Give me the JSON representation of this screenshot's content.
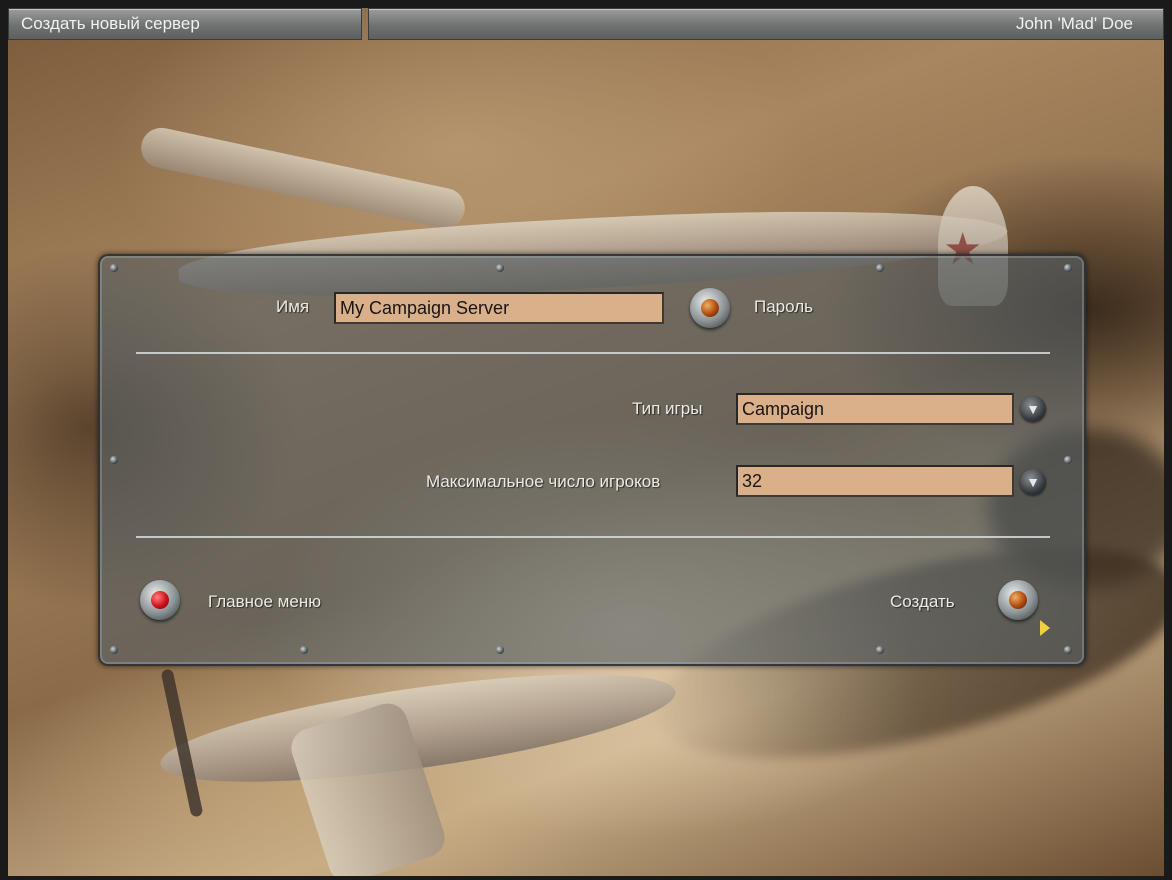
{
  "header": {
    "title": "Создать новый сервер",
    "user": "John 'Mad' Doe"
  },
  "form": {
    "name_label": "Имя",
    "name_value": "My Campaign Server",
    "password_label": "Пароль",
    "game_type_label": "Тип игры",
    "game_type_value": "Campaign",
    "max_players_label": "Максимальное число игроков",
    "max_players_value": "32"
  },
  "footer": {
    "main_menu_label": "Главное меню",
    "create_label": "Создать"
  },
  "icons": {
    "dropdown": "chevron-down-icon",
    "toggle": "lamp-button-icon"
  },
  "colors": {
    "field_bg": "#d9b08a",
    "panel_bg": "#566064",
    "lamp_amber": "#b04a10",
    "lamp_red": "#d0101a"
  }
}
